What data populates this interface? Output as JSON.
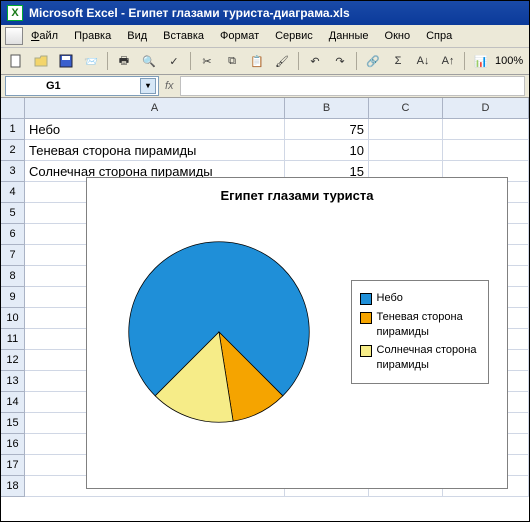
{
  "title": "Microsoft Excel - Египет глазами туриста-диаграма.xls",
  "menu": {
    "file": "Файл",
    "edit": "Правка",
    "view": "Вид",
    "insert": "Вставка",
    "format": "Формат",
    "tools": "Сервис",
    "data": "Данные",
    "window": "Окно",
    "help": "Справка",
    "zoom": "100%"
  },
  "namebox": "G1",
  "columns": [
    "A",
    "B",
    "C",
    "D"
  ],
  "rows": [
    "1",
    "2",
    "3",
    "4",
    "5",
    "6",
    "7",
    "8",
    "9",
    "10",
    "11",
    "12",
    "13",
    "14",
    "15",
    "16",
    "17",
    "18"
  ],
  "cells": {
    "A1": "Небо",
    "B1": "75",
    "A2": "Теневая сторона пирамиды",
    "B2": "10",
    "A3": "Солнечная сторона пирамиды",
    "B3": "15"
  },
  "chart_data": {
    "type": "pie",
    "title": "Египет глазами туриста",
    "categories": [
      "Небо",
      "Теневая сторона пирамиды",
      "Солнечная сторона пирамиды"
    ],
    "values": [
      75,
      10,
      15
    ],
    "colors": [
      "#1f8fd8",
      "#f5a400",
      "#f6ec88"
    ],
    "legend_position": "right"
  }
}
